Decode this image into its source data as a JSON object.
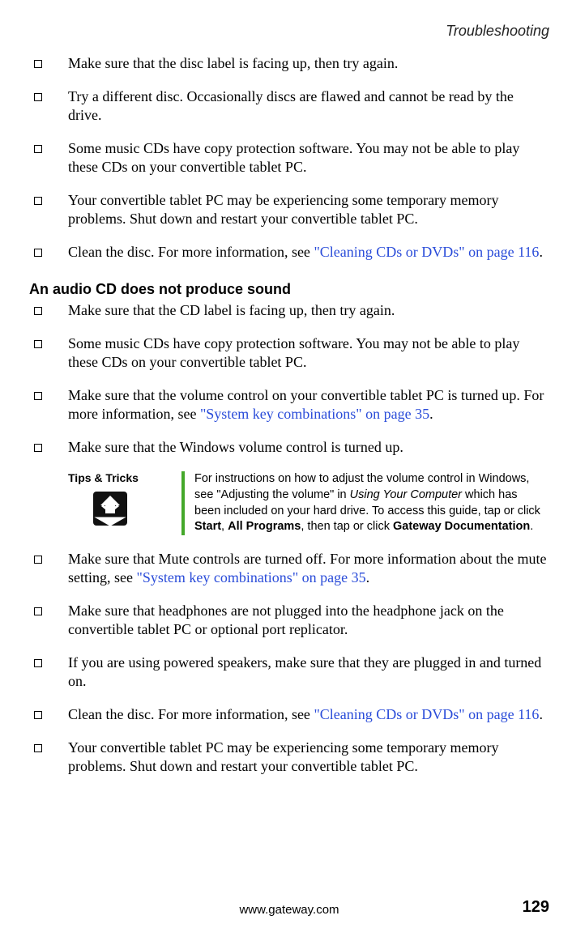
{
  "running_head": "Troubleshooting",
  "bullets_top": [
    {
      "text": "Make sure that the disc label is facing up, then try again."
    },
    {
      "text": "Try a different disc. Occasionally discs are flawed and cannot be read by the drive."
    },
    {
      "text": "Some music CDs have copy protection software. You may not be able to play these CDs on your convertible tablet PC."
    },
    {
      "text": "Your convertible tablet PC may be experiencing some temporary memory problems. Shut down and restart your convertible tablet PC."
    },
    {
      "pre": "Clean the disc. For more information, see ",
      "link": "\"Cleaning CDs or DVDs\" on page 116",
      "post": "."
    }
  ],
  "subheading": "An audio CD does not produce sound",
  "bullets_mid": [
    {
      "text": "Make sure that the CD label is facing up, then try again."
    },
    {
      "text": "Some music CDs have copy protection software. You may not be able to play these CDs on your convertible tablet PC."
    },
    {
      "pre": "Make sure that the volume control on your convertible tablet PC is turned up. For more information, see ",
      "link": "\"System key combinations\" on page 35",
      "post": "."
    },
    {
      "text": "Make sure that the Windows volume control is turned up."
    }
  ],
  "tip": {
    "label": "Tips & Tricks",
    "body_pre": "For instructions on how to adjust the volume control in Windows, see \"Adjusting the volume\" in ",
    "body_em": "Using Your Computer",
    "body_mid": " which has been included on your hard drive. To access this guide, tap or click ",
    "body_b1": "Start",
    "body_sep1": ", ",
    "body_b2": "All Programs",
    "body_sep2": ", then tap or click ",
    "body_b3": "Gateway Documentation",
    "body_post": "."
  },
  "bullets_bottom": [
    {
      "pre": "Make sure that Mute controls are turned off. For more information about the mute setting, see ",
      "link": "\"System key combinations\" on page 35",
      "post": "."
    },
    {
      "text": "Make sure that headphones are not plugged into the headphone jack on the convertible tablet PC or optional port replicator."
    },
    {
      "text": "If you are using powered speakers, make sure that they are plugged in and turned on."
    },
    {
      "pre": "Clean the disc. For more information, see ",
      "link": "\"Cleaning CDs or DVDs\" on page 116",
      "post": "."
    },
    {
      "text": "Your convertible tablet PC may be experiencing some temporary memory problems. Shut down and restart your convertible tablet PC."
    }
  ],
  "footer": {
    "url": "www.gateway.com",
    "page": "129"
  }
}
